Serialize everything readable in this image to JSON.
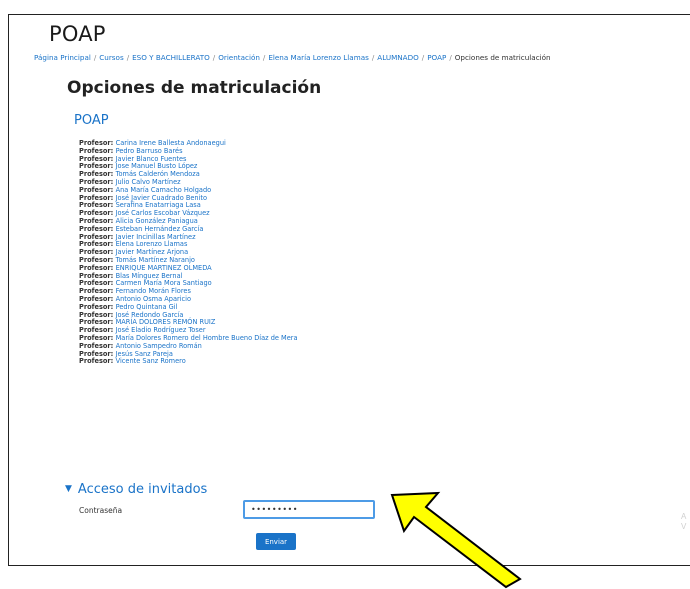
{
  "site_title": "POAP",
  "breadcrumb": {
    "items": [
      "Página Principal",
      "Cursos",
      "ESO Y BACHILLERATO",
      "Orientación",
      "Elena María Lorenzo Llamas",
      "ALUMNADO",
      "POAP"
    ],
    "separator": "/",
    "current": "Opciones de matriculación"
  },
  "page_heading": "Opciones de matriculación",
  "course_name": "POAP",
  "teacher_role_label": "Profesor: ",
  "teachers": [
    "Carina Irene Ballesta Andonaegui",
    "Pedro Barruso Barés",
    "Javier Blanco Fuentes",
    "Jose Manuel Busto López",
    "Tomás Calderón Mendoza",
    "Julio Calvo Martínez",
    "Ana María Camacho Holgado",
    "José Javier Cuadrado Benito",
    "Serafina Enatarriaga Lasa",
    "José Carlos Escobar Vázquez",
    "Alicia González Paniagua",
    "Esteban Hernández García",
    "Javier Incinillas Martínez",
    "Elena Lorenzo Llamas",
    "Javier Martínez Arjona",
    "Tomás Martínez Naranjo",
    "ENRIQUE MARTINEZ OLMEDA",
    "Blas Mínguez Bernal",
    "Carmen María Mora Santiago",
    "Fernando Morán Flores",
    "Antonio Osma Aparicio",
    "Pedro Quintana Gil",
    "José Redondo García",
    "MARÍA DOLORES REMÓN RUIZ",
    "José Eladio Rodríguez Toser",
    "María Dolores Romero del Hombre Bueno Díaz de Mera",
    "Antonio Sampedro Román",
    "Jesús Sanz Pareja",
    "Vicente Sanz Romero"
  ],
  "guest_access": {
    "heading": "Acceso de invitados",
    "password_label": "Contraseña",
    "password_value": "•••••••••",
    "submit_label": "Enviar"
  },
  "watermark_text": "A V",
  "colors": {
    "link": "#1a73c8",
    "button": "#1a73c8",
    "arrow_fill": "#ffff00",
    "input_border": "#4d9be6"
  }
}
